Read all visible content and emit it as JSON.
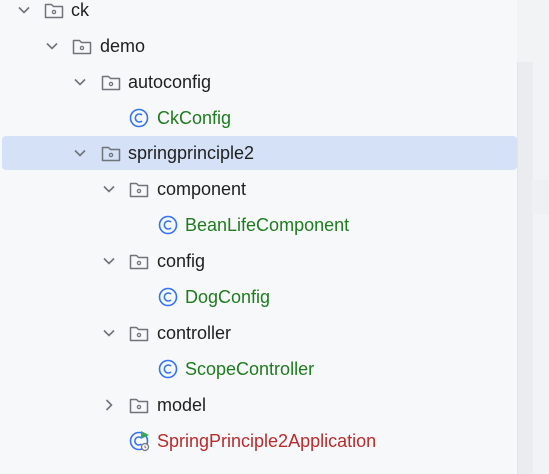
{
  "tree": {
    "rows": [
      {
        "label": "ck",
        "type": "folder",
        "expanded": true
      },
      {
        "label": "demo",
        "type": "folder",
        "expanded": true
      },
      {
        "label": "autoconfig",
        "type": "folder",
        "expanded": true
      },
      {
        "label": "CkConfig",
        "type": "class"
      },
      {
        "label": "springprinciple2",
        "type": "folder",
        "expanded": true,
        "selected": true
      },
      {
        "label": "component",
        "type": "folder",
        "expanded": true
      },
      {
        "label": "BeanLifeComponent",
        "type": "class"
      },
      {
        "label": "config",
        "type": "folder",
        "expanded": true
      },
      {
        "label": "DogConfig",
        "type": "class"
      },
      {
        "label": "controller",
        "type": "folder",
        "expanded": true
      },
      {
        "label": "ScopeController",
        "type": "class"
      },
      {
        "label": "model",
        "type": "folder",
        "expanded": false
      },
      {
        "label": "SpringPrinciple2Application",
        "type": "app-class"
      }
    ]
  },
  "colors": {
    "selection": "#d5e1f7",
    "class_text": "#1e7b1e",
    "app_text": "#b72c2c",
    "class_icon": "#3574f0"
  }
}
